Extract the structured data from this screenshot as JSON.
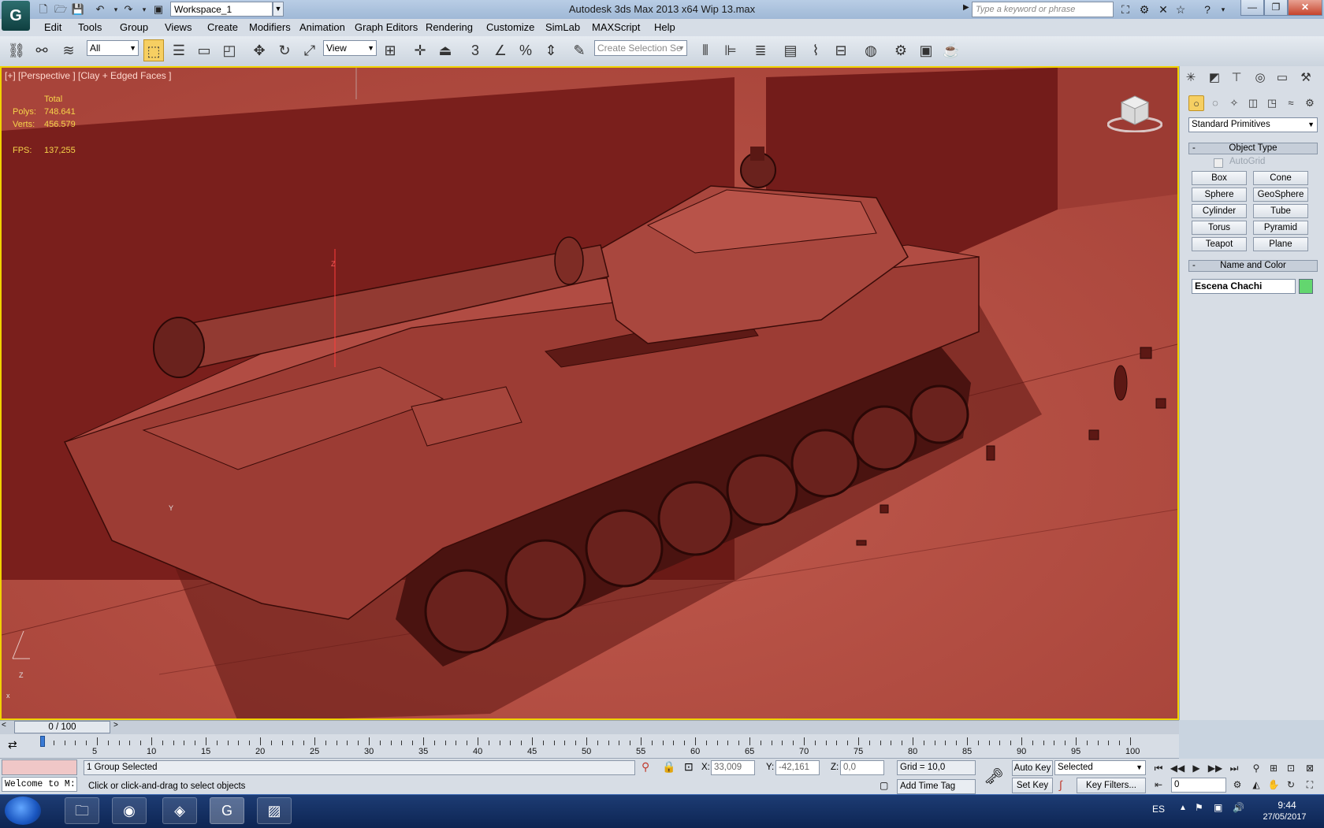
{
  "titlebar": {
    "app_logo": "G",
    "workspace": "Workspace_1",
    "title": "Autodesk 3ds Max  2013 x64      Wip 13.max",
    "search_placeholder": "Type a keyword or phrase"
  },
  "menu": [
    "Edit",
    "Tools",
    "Group",
    "Views",
    "Create",
    "Modifiers",
    "Animation",
    "Graph Editors",
    "Rendering",
    "Customize",
    "SimLab",
    "MAXScript",
    "Help"
  ],
  "toolbar": {
    "selection_filter": "All",
    "reference_coord": "View",
    "snap_number": "3",
    "named_selection_placeholder": "Create Selection Se"
  },
  "viewport": {
    "label": "[+] [Perspective ] [Clay + Edged Faces ]",
    "stats_header": "Total",
    "polys_label": "Polys:",
    "polys_value": "748.641",
    "verts_label": "Verts:",
    "verts_value": "456.579",
    "fps_label": "FPS:",
    "fps_value": "137,255",
    "viewcube_label": "ViewCube",
    "axis_z": "Z",
    "axis_y": "Y",
    "axis_x": "x"
  },
  "command_panel": {
    "primitive_type": "Standard Primitives",
    "object_type_title": "Object Type",
    "autogrid": "AutoGrid",
    "buttons": [
      "Box",
      "Cone",
      "Sphere",
      "GeoSphere",
      "Cylinder",
      "Tube",
      "Torus",
      "Pyramid",
      "Teapot",
      "Plane"
    ],
    "name_color_title": "Name and Color",
    "object_name": "Escena Chachi",
    "object_color": "#63d66f"
  },
  "timeline": {
    "frame_display": "0 / 100",
    "tick_labels": [
      "5",
      "10",
      "15",
      "20",
      "25",
      "30",
      "35",
      "40",
      "45",
      "50",
      "55",
      "60",
      "65",
      "70",
      "75",
      "80",
      "85",
      "90",
      "95",
      "100"
    ],
    "current_frame_fraction": 0.0
  },
  "status": {
    "selection_info": "1 Group Selected",
    "prompt": "Click or click-and-drag to select objects",
    "maxscript_listener": "Welcome to M:",
    "x_label": "X:",
    "x_value": "33,009",
    "y_label": "Y:",
    "y_value": "-42,161",
    "z_label": "Z:",
    "z_value": "0,0",
    "grid": "Grid = 10,0",
    "add_time_tag": "Add Time Tag",
    "auto_key": "Auto Key",
    "set_key": "Set Key",
    "key_mode": "Selected",
    "key_filters": "Key Filters...",
    "frame_field": "0"
  },
  "taskbar": {
    "language": "ES",
    "time": "9:44",
    "date": "27/05/2017"
  },
  "colors": {
    "viewport_bg": "#b24a40",
    "active_border": "#f0d200",
    "stats_text": "#f6d44a"
  }
}
